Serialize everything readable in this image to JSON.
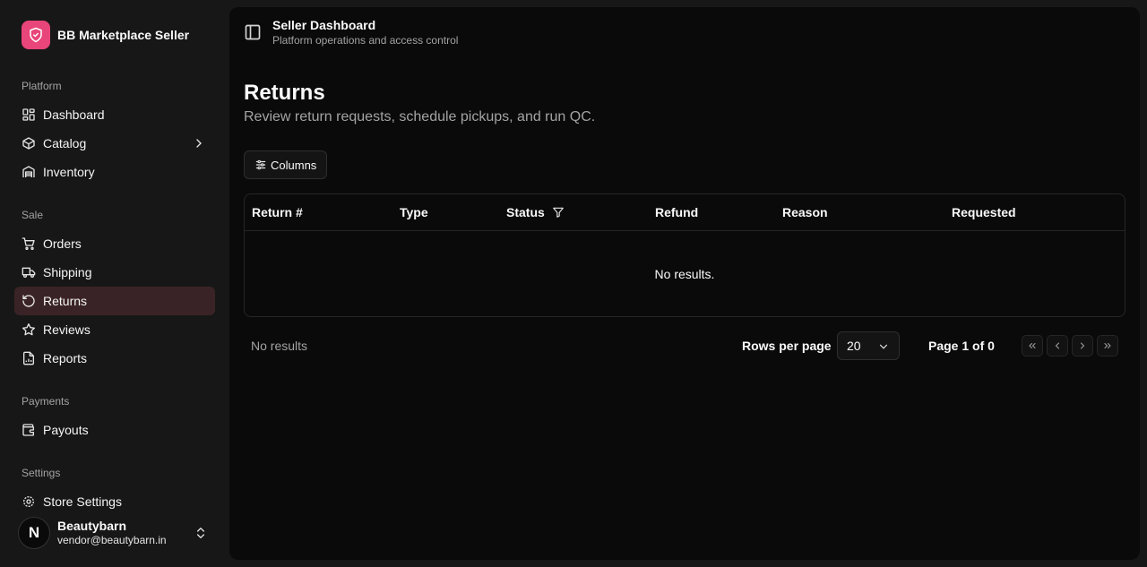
{
  "brand": {
    "name": "BB Marketplace Seller",
    "accent": "#e8457a"
  },
  "sidebar": {
    "groups": [
      {
        "label": "Platform",
        "items": [
          {
            "label": "Dashboard",
            "icon": "layout-dashboard-icon"
          },
          {
            "label": "Catalog",
            "icon": "package-icon",
            "has_submenu": true
          },
          {
            "label": "Inventory",
            "icon": "warehouse-icon"
          }
        ]
      },
      {
        "label": "Sale",
        "items": [
          {
            "label": "Orders",
            "icon": "shopping-cart-icon"
          },
          {
            "label": "Shipping",
            "icon": "truck-icon"
          },
          {
            "label": "Returns",
            "icon": "rotate-ccw-icon",
            "active": true
          },
          {
            "label": "Reviews",
            "icon": "star-icon"
          },
          {
            "label": "Reports",
            "icon": "file-chart-icon"
          }
        ]
      },
      {
        "label": "Payments",
        "items": [
          {
            "label": "Payouts",
            "icon": "wallet-icon"
          }
        ]
      },
      {
        "label": "Settings",
        "items": [
          {
            "label": "Store Settings",
            "icon": "settings-icon"
          }
        ]
      }
    ]
  },
  "user": {
    "avatar_letter": "N",
    "name": "Beautybarn",
    "email": "vendor@beautybarn.in"
  },
  "header": {
    "title": "Seller Dashboard",
    "subtitle": "Platform operations and access control"
  },
  "page": {
    "title": "Returns",
    "subtitle": "Review return requests, schedule pickups, and run QC."
  },
  "toolbar": {
    "columns_label": "Columns"
  },
  "table": {
    "columns": [
      "Return #",
      "Type",
      "Status",
      "Refund",
      "Reason",
      "Requested"
    ],
    "empty_text": "No results."
  },
  "footer": {
    "summary": "No results",
    "rows_per_page_label": "Rows per page",
    "rows_per_page_value": "20",
    "page_info": "Page 1 of 0"
  }
}
